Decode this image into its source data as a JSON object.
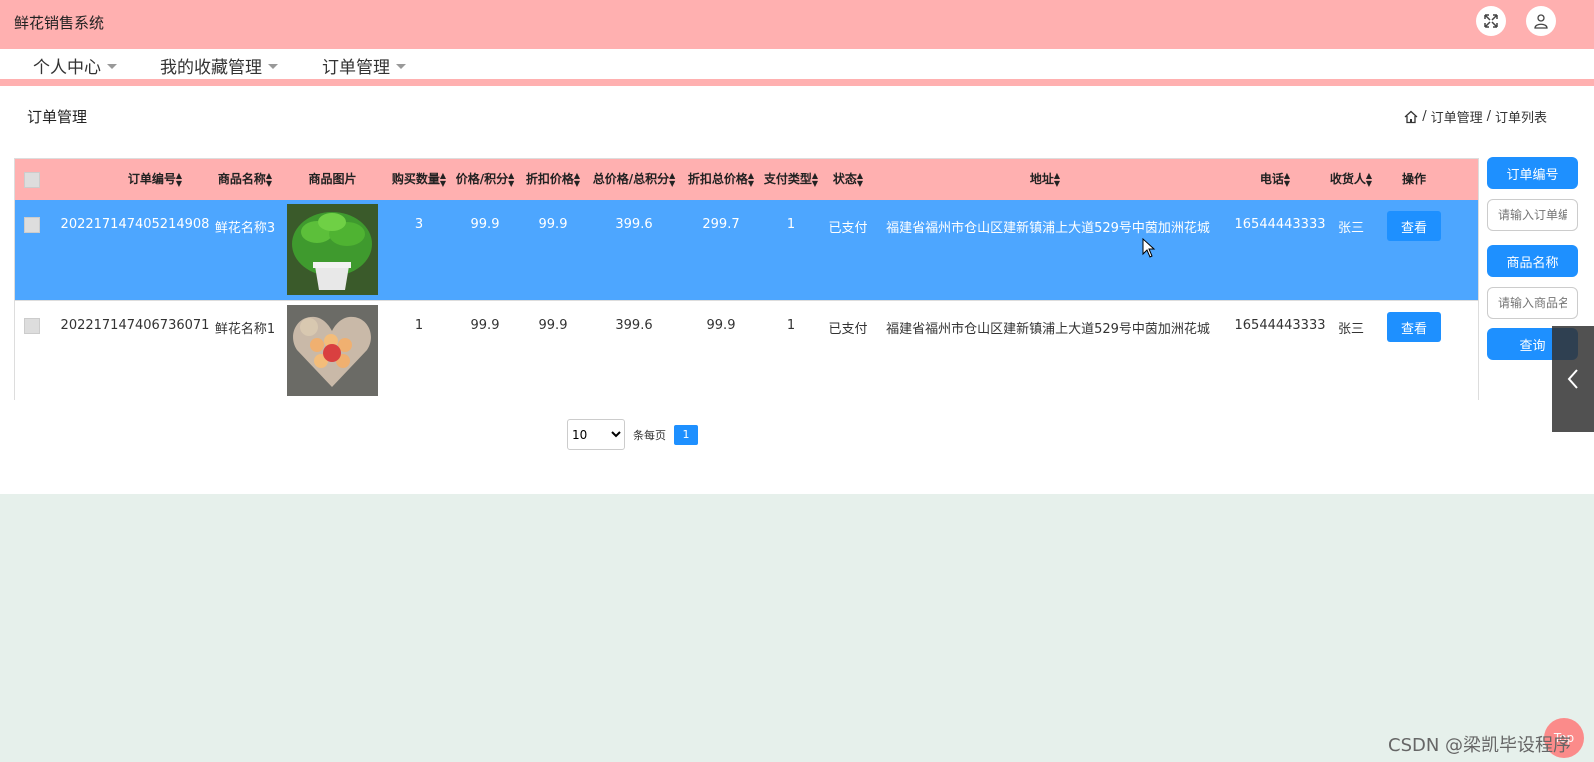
{
  "app": {
    "title": "鲜花销售系统"
  },
  "top_icons": [
    "fullscreen-icon",
    "user-icon"
  ],
  "nav": {
    "items": [
      {
        "label": "个人中心"
      },
      {
        "label": "我的收藏管理"
      },
      {
        "label": "订单管理"
      }
    ]
  },
  "page": {
    "title": "订单管理"
  },
  "breadcrumb": {
    "items": [
      "订单管理",
      "订单列表"
    ],
    "separator": "/"
  },
  "table": {
    "headers": [
      "订单编号",
      "商品名称",
      "商品图片",
      "购买数量",
      "价格/积分",
      "折扣价格",
      "总价格/总积分",
      "折扣总价格",
      "支付类型",
      "状态",
      "地址",
      "电话",
      "收货人",
      "操作"
    ],
    "rows": [
      {
        "order_no": "202217147405214908",
        "product": "鲜花名称3",
        "image": "green-plant-potted",
        "qty": "3",
        "price": "99.9",
        "discount_price": "99.9",
        "total": "399.6",
        "discount_total": "299.7",
        "pay_type": "1",
        "status": "已支付",
        "address": "福建省福州市仓山区建新镇浦上大道529号中茵加洲花城",
        "phone": "16544443333",
        "receiver": "张三",
        "action": "查看"
      },
      {
        "order_no": "202217147406736071",
        "product": "鲜花名称1",
        "image": "heart-rose-box-with-apple",
        "qty": "1",
        "price": "99.9",
        "discount_price": "99.9",
        "total": "399.6",
        "discount_total": "99.9",
        "pay_type": "1",
        "status": "已支付",
        "address": "福建省福州市仓山区建新镇浦上大道529号中茵加洲花城",
        "phone": "16544443333",
        "receiver": "张三",
        "action": "查看"
      }
    ]
  },
  "pager": {
    "page_size": "10",
    "per_page_label": "条每页",
    "current_page": "1"
  },
  "search": {
    "order_no_label": "订单编号",
    "order_no_placeholder": "请输入订单编号",
    "product_label": "商品名称",
    "product_placeholder": "请输入商品名称",
    "query_label": "查询"
  },
  "back_to_top": "Top",
  "watermark": "CSDN @梁凯毕设程序",
  "colors": {
    "topbar": "#ffb0b0",
    "primary": "#1e90ff",
    "selected_row": "#4da6ff",
    "background": "#e6f0eb"
  }
}
